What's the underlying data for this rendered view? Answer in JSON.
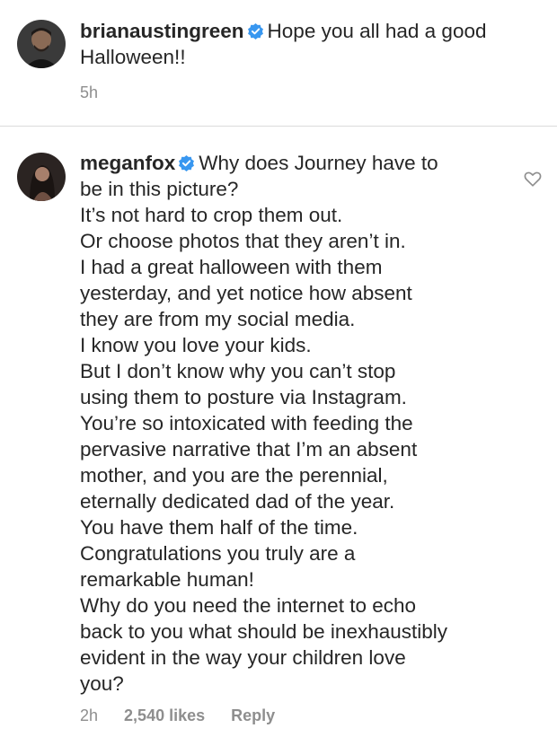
{
  "caption": {
    "username": "brianaustingreen",
    "verified": true,
    "text_lines": [
      "Hope you all had a good",
      "Halloween!!"
    ],
    "time": "5h"
  },
  "comment": {
    "username": "meganfox",
    "verified": true,
    "first_line": "Why does Journey have to",
    "text_lines": [
      "be in this picture?",
      "It’s not hard to crop them out.",
      "Or choose photos that they aren’t in.",
      "I had a great halloween with them",
      "yesterday, and yet notice how absent",
      "they are from my social media.",
      "I know you love your kids.",
      "But I don’t know why you can’t stop",
      "using them to posture via Instagram.",
      "You’re so intoxicated with feeding the",
      "pervasive narrative that I’m an absent",
      "mother, and you are the perennial,",
      "eternally dedicated dad of the year.",
      "You have them half of the time.",
      "Congratulations you truly are a",
      "remarkable human!",
      "Why do you need the internet to echo",
      "back to you what should be inexhaustibly",
      "evident in the way your children love",
      "you?"
    ],
    "time": "2h",
    "likes": "2,540 likes",
    "reply_label": "Reply"
  },
  "icons": {
    "verified": "verified-badge-icon",
    "like": "heart-icon"
  },
  "colors": {
    "text": "#262626",
    "secondary": "#8e8e8e",
    "verified": "#3897f0",
    "divider": "#dbdbdb"
  }
}
